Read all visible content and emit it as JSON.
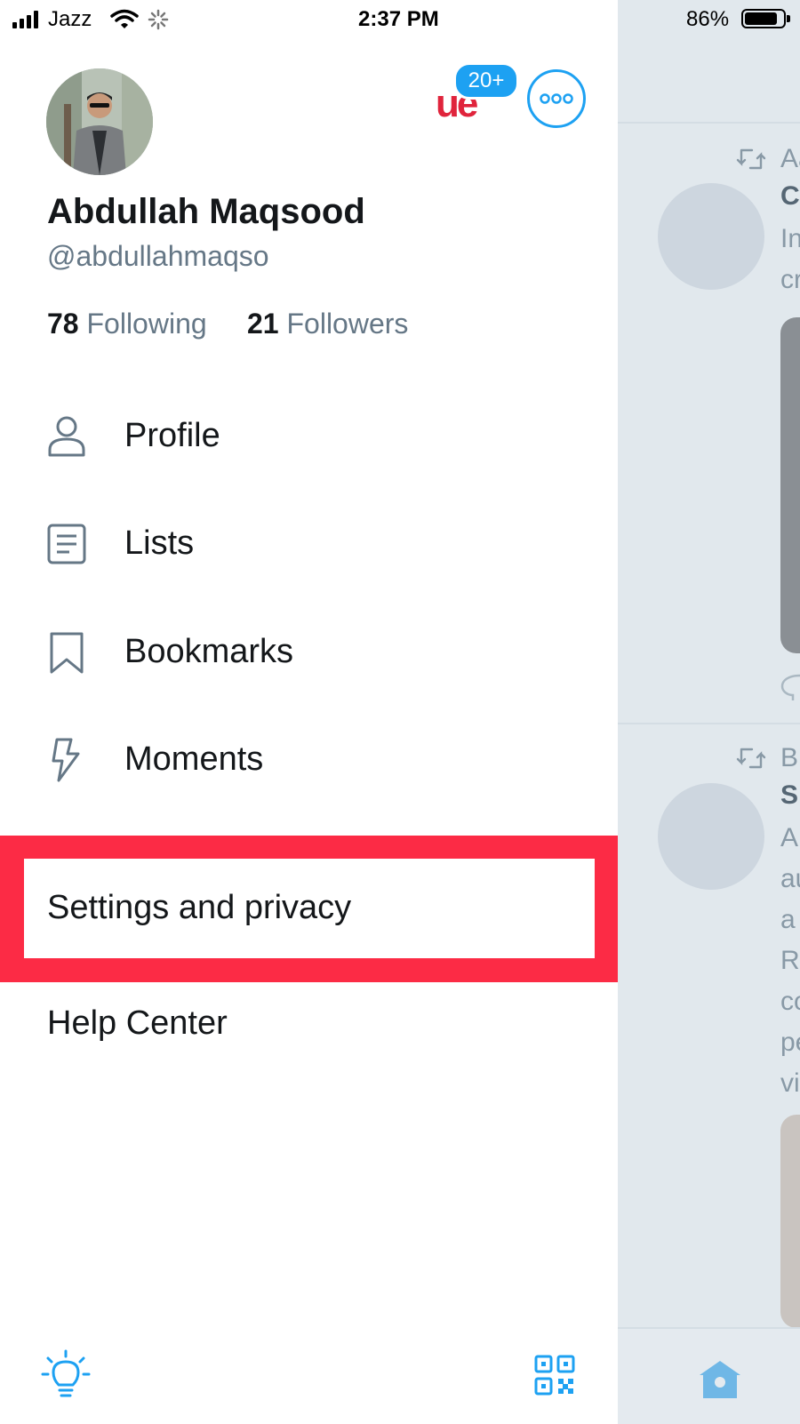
{
  "status_bar": {
    "carrier": "Jazz",
    "time": "2:37 PM",
    "battery": "86%",
    "battery_level": 0.86
  },
  "profile": {
    "name": "Abdullah Maqsood",
    "handle": "@abdullahmaqso",
    "following_count": "78",
    "following_label": "Following",
    "followers_count": "21",
    "followers_label": "Followers",
    "notification_badge": "20+"
  },
  "menu": {
    "items": [
      {
        "label": "Profile",
        "icon": "person-icon"
      },
      {
        "label": "Lists",
        "icon": "list-icon"
      },
      {
        "label": "Bookmarks",
        "icon": "bookmark-icon"
      },
      {
        "label": "Moments",
        "icon": "lightning-icon"
      }
    ],
    "settings_label": "Settings and privacy",
    "help_label": "Help Center"
  },
  "footer": {
    "left_icon": "lightbulb-icon",
    "right_icon": "qr-code-icon"
  },
  "timeline_peek": {
    "tweets": [
      {
        "retweet_by": "Aa",
        "title": "C",
        "lines": [
          "In",
          "cr"
        ]
      },
      {
        "retweet_by": "Bl",
        "title": "S",
        "lines": [
          "A",
          "au",
          "a",
          "R",
          "co",
          "pe",
          "vi"
        ]
      }
    ]
  },
  "colors": {
    "accent": "#1da1f2",
    "highlight": "#fc2b45",
    "secondary_text": "#657786",
    "timeline_bg": "#e1e8ed"
  }
}
